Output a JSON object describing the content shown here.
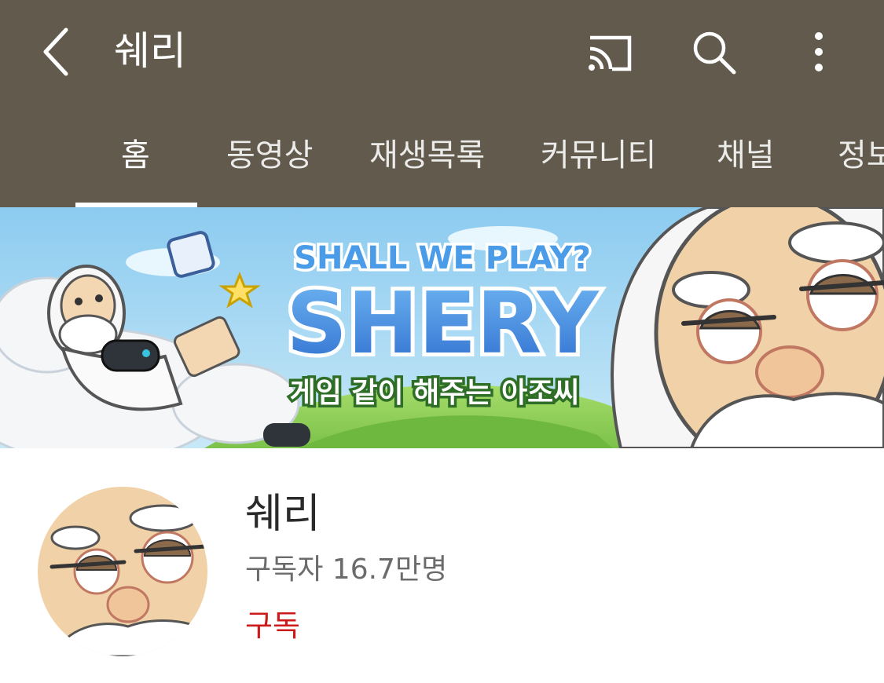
{
  "header": {
    "title": "쉐리",
    "tabs": [
      "홈",
      "동영상",
      "재생목록",
      "커뮤니티",
      "채널",
      "정보"
    ],
    "active_tab": 0,
    "icons": [
      "back-arrow-icon",
      "cast-icon",
      "search-icon",
      "more-vert-icon"
    ]
  },
  "banner": {
    "line1": "SHALL WE PLAY?",
    "line2": "SHERY",
    "line3": "게임 같이 해주는 아조씨"
  },
  "channel": {
    "name": "쉐리",
    "subscribers": "구독자 16.7만명",
    "subscribe_label": "구독"
  },
  "colors": {
    "appbar": "#625a4d",
    "subscribe": "#cc1a1a",
    "banner_sky": "#9fd3f0",
    "banner_grass": "#8fcf5a"
  }
}
